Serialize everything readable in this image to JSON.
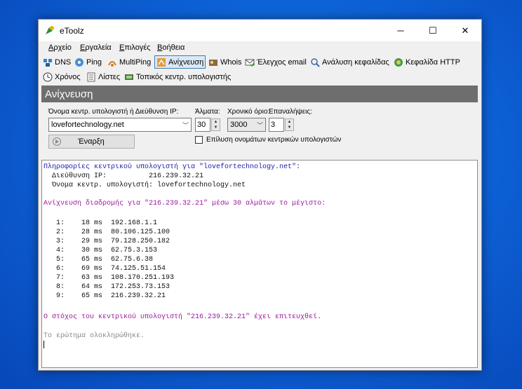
{
  "window": {
    "title": "eToolz"
  },
  "menu": [
    {
      "first": "Α",
      "rest": "ρχείο"
    },
    {
      "first": "Ε",
      "rest": "ργαλεία"
    },
    {
      "first": "Ε",
      "rest": "πιλογές"
    },
    {
      "first": "Β",
      "rest": "οήθεια"
    }
  ],
  "toolbar_row1": [
    {
      "label": "DNS",
      "icon": "dns-icon"
    },
    {
      "label": "Ping",
      "icon": "ping-icon"
    },
    {
      "label": "MultiPing",
      "icon": "multiping-icon"
    },
    {
      "label": "Ανίχνευση",
      "icon": "traceroute-icon"
    },
    {
      "label": "Whois",
      "icon": "whois-icon"
    },
    {
      "label": "Έλεγχος email",
      "icon": "email-check-icon"
    },
    {
      "label": "Ανάλυση κεφαλίδας",
      "icon": "header-analysis-icon"
    },
    {
      "label": "Κεφαλίδα HTTP",
      "icon": "http-header-icon"
    }
  ],
  "toolbar_row2": [
    {
      "label": "Χρόνος",
      "icon": "clock-icon"
    },
    {
      "label": "Λίστες",
      "icon": "list-icon"
    },
    {
      "label": "Τοπικός κεντρ. υπολογιστής",
      "icon": "local-host-icon"
    }
  ],
  "section_title": "Ανίχνευση",
  "form": {
    "host_label": "Όνομα κεντρ. υπολογιστή ή Διεύθυνση IP:",
    "host_value": "lovefortechnology.net",
    "hops_label": "Άλματα:",
    "hops_value": "30",
    "timeout_label": "Χρονικό όριο:",
    "timeout_value": "3000",
    "retries_label": "Επαναλήψεις:",
    "retries_value": "3",
    "start_label": "Έναρξη",
    "resolve_label": "Επίλυση ονομάτων κεντρικών υπολογιστών"
  },
  "output": {
    "info_heading": "Πληροφορίες κεντρικού υπολογιστή για \"lovefortechnology.net\":",
    "ip_line": "  Διεύθυνση IP:          216.239.32.21",
    "name_line": "  Όνομα κεντρ. υπολογιστή: lovefortechnology.net",
    "trace_heading": "Ανίχνευση διαδρομής για \"216.239.32.21\" μέσω 30 αλμάτων το μέγιστο:",
    "hops": [
      "   1:    18 ms  192.168.1.1",
      "   2:    28 ms  80.106.125.100",
      "   3:    29 ms  79.128.250.182",
      "   4:    30 ms  62.75.3.153",
      "   5:    65 ms  62.75.6.38",
      "   6:    69 ms  74.125.51.154",
      "   7:    63 ms  108.170.251.193",
      "   8:    64 ms  172.253.73.153",
      "   9:    65 ms  216.239.32.21"
    ],
    "reached": "Ο στόχος του κεντρικού υπολογιστή \"216.239.32.21\" έχει επιτευχθεί.",
    "done": "Το ερώτημα ολοκληρώθηκε."
  }
}
